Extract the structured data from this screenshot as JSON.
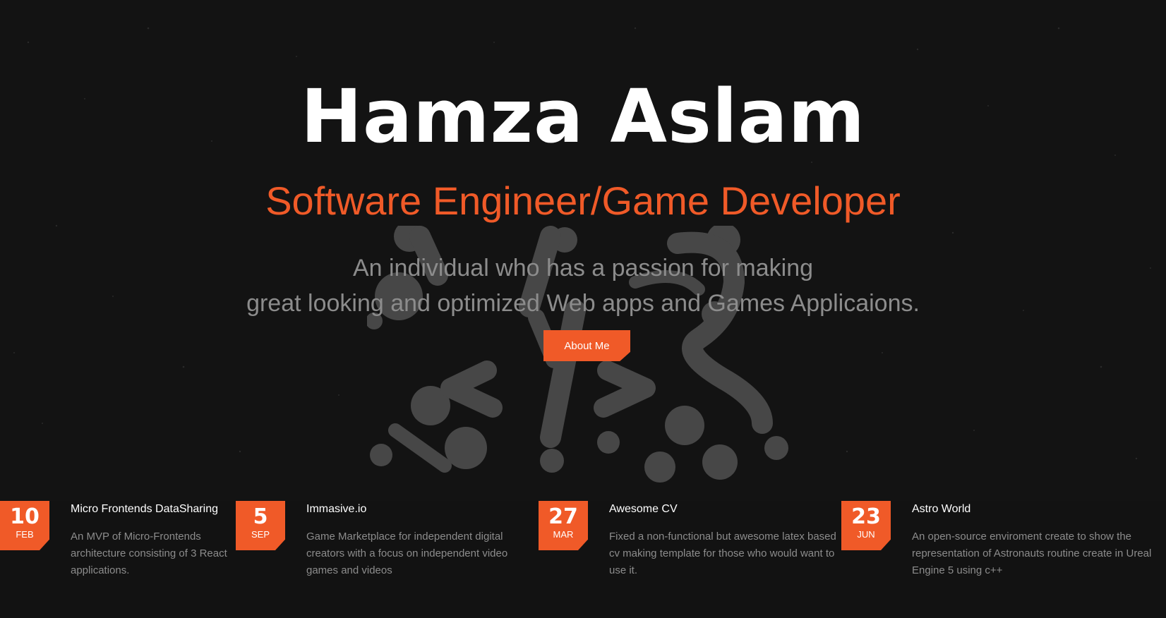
{
  "hero": {
    "title": "Hamza Aslam",
    "subtitle": "Software Engineer/Game Developer",
    "description_line1": "An individual who has a passion for making",
    "description_line2": "great looking and optimized Web apps and Games Applicaions.",
    "button_label": "About Me"
  },
  "posts": [
    {
      "day": "10",
      "month": "FEB",
      "title": "Micro Frontends DataSharing",
      "description": "An MVP of Micro-Frontends architecture consisting of 3 React applications."
    },
    {
      "day": "5",
      "month": "SEP",
      "title": "Immasive.io",
      "description": "Game Marketplace for independent digital creators with a focus on independent video games and videos"
    },
    {
      "day": "27",
      "month": "MAR",
      "title": "Awesome CV",
      "description": "Fixed a non-functional but awesome latex based cv making template for those who would want to use it."
    },
    {
      "day": "23",
      "month": "JUN",
      "title": "Astro World",
      "description": "An open-source enviroment create to show the representation of Astronauts routine create in Ureal Engine 5 using c++"
    }
  ],
  "colors": {
    "accent": "#f05a28",
    "background": "#121212",
    "muted_text": "#8c8c8c",
    "logo_gray": "#4a4a4a"
  },
  "icons": {
    "logo": "code-brackets-logo-icon"
  }
}
